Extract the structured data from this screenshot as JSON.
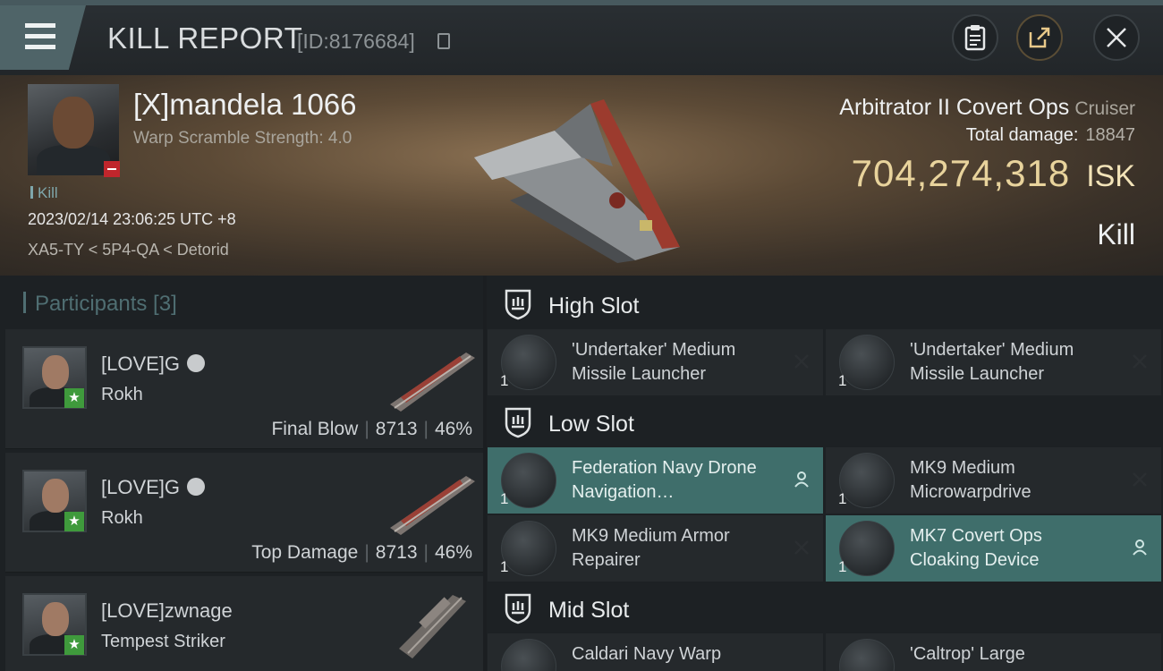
{
  "header": {
    "title": "KILL REPORT",
    "kill_id": "[ID:8176684]"
  },
  "victim": {
    "name": "[X]mandela 1066",
    "warp_scramble": "Warp Scramble Strength: 4.0",
    "tag": "Kill",
    "date": "2023/02/14 23:06:25 UTC +8",
    "location": "XA5-TY < 5P4-QA < Detorid",
    "ship_name": "Arbitrator II Covert Ops",
    "ship_class": "Cruiser",
    "total_damage_label": "Total damage:",
    "total_damage_value": "18847",
    "isk_value": "704,274,318",
    "isk_unit": "ISK",
    "result": "Kill"
  },
  "participants": {
    "title": "Participants [3]",
    "items": [
      {
        "name": "[LOVE]G",
        "ship": "Rokh",
        "role": "Final Blow",
        "damage": "8713",
        "percent": "46%"
      },
      {
        "name": "[LOVE]G",
        "ship": "Rokh",
        "role": "Top Damage",
        "damage": "8713",
        "percent": "46%"
      },
      {
        "name": "[LOVE]zwnage",
        "ship": "Tempest Striker",
        "role": "",
        "damage": "",
        "percent": ""
      }
    ]
  },
  "fittings": {
    "high_slot": {
      "label": "High Slot",
      "modules": [
        {
          "name": "'Undertaker' Medium Missile Launcher",
          "qty": "1",
          "status": "destroyed"
        },
        {
          "name": "'Undertaker' Medium Missile Launcher",
          "qty": "1",
          "status": "destroyed"
        }
      ]
    },
    "low_slot": {
      "label": "Low Slot",
      "modules": [
        {
          "name": "Federation Navy Drone Navigation…",
          "qty": "1",
          "status": "dropped"
        },
        {
          "name": "MK9 Medium Microwarpdrive",
          "qty": "1",
          "status": "destroyed"
        },
        {
          "name": "MK9 Medium Armor Repairer",
          "qty": "1",
          "status": "destroyed"
        },
        {
          "name": "MK7 Covert Ops Cloaking Device",
          "qty": "1",
          "status": "dropped"
        }
      ]
    },
    "mid_slot": {
      "label": "Mid Slot",
      "modules": [
        {
          "name": "Caldari Navy Warp",
          "qty": "",
          "status": "destroyed"
        },
        {
          "name": "'Caltrop' Large",
          "qty": "",
          "status": "destroyed"
        }
      ]
    }
  },
  "colors": {
    "accent_teal": "#4f6468",
    "isk_gold": "#e8d39c",
    "dropped_highlight": "#3f6e6b",
    "badge_green": "#3f9a3c",
    "badge_red": "#c0262c"
  },
  "icons": [
    "menu-icon",
    "copy-icon",
    "clipboard-icon",
    "share-icon",
    "close-icon",
    "minus-icon",
    "star-icon",
    "online-dot-icon",
    "shield-slot-icon",
    "destroyed-x-icon",
    "person-icon"
  ]
}
